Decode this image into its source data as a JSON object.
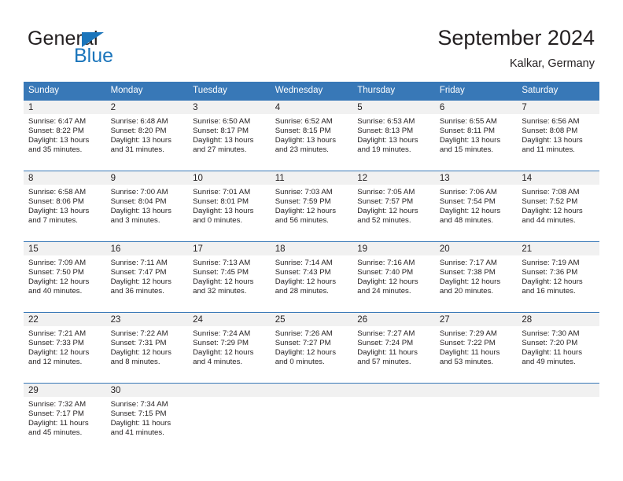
{
  "brand": {
    "name_part1": "General",
    "name_part2": "Blue",
    "triangle_color": "#1b75bb"
  },
  "header": {
    "title": "September 2024",
    "subtitle": "Kalkar, Germany"
  },
  "theme": {
    "header_blue": "#3878b7",
    "daynum_band": "#f1f1f1",
    "text": "#231f20"
  },
  "weekday_headers": [
    "Sunday",
    "Monday",
    "Tuesday",
    "Wednesday",
    "Thursday",
    "Friday",
    "Saturday"
  ],
  "weeks": [
    [
      {
        "day": "1",
        "sunrise": "Sunrise: 6:47 AM",
        "sunset": "Sunset: 8:22 PM",
        "daylight1": "Daylight: 13 hours",
        "daylight2": "and 35 minutes."
      },
      {
        "day": "2",
        "sunrise": "Sunrise: 6:48 AM",
        "sunset": "Sunset: 8:20 PM",
        "daylight1": "Daylight: 13 hours",
        "daylight2": "and 31 minutes."
      },
      {
        "day": "3",
        "sunrise": "Sunrise: 6:50 AM",
        "sunset": "Sunset: 8:17 PM",
        "daylight1": "Daylight: 13 hours",
        "daylight2": "and 27 minutes."
      },
      {
        "day": "4",
        "sunrise": "Sunrise: 6:52 AM",
        "sunset": "Sunset: 8:15 PM",
        "daylight1": "Daylight: 13 hours",
        "daylight2": "and 23 minutes."
      },
      {
        "day": "5",
        "sunrise": "Sunrise: 6:53 AM",
        "sunset": "Sunset: 8:13 PM",
        "daylight1": "Daylight: 13 hours",
        "daylight2": "and 19 minutes."
      },
      {
        "day": "6",
        "sunrise": "Sunrise: 6:55 AM",
        "sunset": "Sunset: 8:11 PM",
        "daylight1": "Daylight: 13 hours",
        "daylight2": "and 15 minutes."
      },
      {
        "day": "7",
        "sunrise": "Sunrise: 6:56 AM",
        "sunset": "Sunset: 8:08 PM",
        "daylight1": "Daylight: 13 hours",
        "daylight2": "and 11 minutes."
      }
    ],
    [
      {
        "day": "8",
        "sunrise": "Sunrise: 6:58 AM",
        "sunset": "Sunset: 8:06 PM",
        "daylight1": "Daylight: 13 hours",
        "daylight2": "and 7 minutes."
      },
      {
        "day": "9",
        "sunrise": "Sunrise: 7:00 AM",
        "sunset": "Sunset: 8:04 PM",
        "daylight1": "Daylight: 13 hours",
        "daylight2": "and 3 minutes."
      },
      {
        "day": "10",
        "sunrise": "Sunrise: 7:01 AM",
        "sunset": "Sunset: 8:01 PM",
        "daylight1": "Daylight: 13 hours",
        "daylight2": "and 0 minutes."
      },
      {
        "day": "11",
        "sunrise": "Sunrise: 7:03 AM",
        "sunset": "Sunset: 7:59 PM",
        "daylight1": "Daylight: 12 hours",
        "daylight2": "and 56 minutes."
      },
      {
        "day": "12",
        "sunrise": "Sunrise: 7:05 AM",
        "sunset": "Sunset: 7:57 PM",
        "daylight1": "Daylight: 12 hours",
        "daylight2": "and 52 minutes."
      },
      {
        "day": "13",
        "sunrise": "Sunrise: 7:06 AM",
        "sunset": "Sunset: 7:54 PM",
        "daylight1": "Daylight: 12 hours",
        "daylight2": "and 48 minutes."
      },
      {
        "day": "14",
        "sunrise": "Sunrise: 7:08 AM",
        "sunset": "Sunset: 7:52 PM",
        "daylight1": "Daylight: 12 hours",
        "daylight2": "and 44 minutes."
      }
    ],
    [
      {
        "day": "15",
        "sunrise": "Sunrise: 7:09 AM",
        "sunset": "Sunset: 7:50 PM",
        "daylight1": "Daylight: 12 hours",
        "daylight2": "and 40 minutes."
      },
      {
        "day": "16",
        "sunrise": "Sunrise: 7:11 AM",
        "sunset": "Sunset: 7:47 PM",
        "daylight1": "Daylight: 12 hours",
        "daylight2": "and 36 minutes."
      },
      {
        "day": "17",
        "sunrise": "Sunrise: 7:13 AM",
        "sunset": "Sunset: 7:45 PM",
        "daylight1": "Daylight: 12 hours",
        "daylight2": "and 32 minutes."
      },
      {
        "day": "18",
        "sunrise": "Sunrise: 7:14 AM",
        "sunset": "Sunset: 7:43 PM",
        "daylight1": "Daylight: 12 hours",
        "daylight2": "and 28 minutes."
      },
      {
        "day": "19",
        "sunrise": "Sunrise: 7:16 AM",
        "sunset": "Sunset: 7:40 PM",
        "daylight1": "Daylight: 12 hours",
        "daylight2": "and 24 minutes."
      },
      {
        "day": "20",
        "sunrise": "Sunrise: 7:17 AM",
        "sunset": "Sunset: 7:38 PM",
        "daylight1": "Daylight: 12 hours",
        "daylight2": "and 20 minutes."
      },
      {
        "day": "21",
        "sunrise": "Sunrise: 7:19 AM",
        "sunset": "Sunset: 7:36 PM",
        "daylight1": "Daylight: 12 hours",
        "daylight2": "and 16 minutes."
      }
    ],
    [
      {
        "day": "22",
        "sunrise": "Sunrise: 7:21 AM",
        "sunset": "Sunset: 7:33 PM",
        "daylight1": "Daylight: 12 hours",
        "daylight2": "and 12 minutes."
      },
      {
        "day": "23",
        "sunrise": "Sunrise: 7:22 AM",
        "sunset": "Sunset: 7:31 PM",
        "daylight1": "Daylight: 12 hours",
        "daylight2": "and 8 minutes."
      },
      {
        "day": "24",
        "sunrise": "Sunrise: 7:24 AM",
        "sunset": "Sunset: 7:29 PM",
        "daylight1": "Daylight: 12 hours",
        "daylight2": "and 4 minutes."
      },
      {
        "day": "25",
        "sunrise": "Sunrise: 7:26 AM",
        "sunset": "Sunset: 7:27 PM",
        "daylight1": "Daylight: 12 hours",
        "daylight2": "and 0 minutes."
      },
      {
        "day": "26",
        "sunrise": "Sunrise: 7:27 AM",
        "sunset": "Sunset: 7:24 PM",
        "daylight1": "Daylight: 11 hours",
        "daylight2": "and 57 minutes."
      },
      {
        "day": "27",
        "sunrise": "Sunrise: 7:29 AM",
        "sunset": "Sunset: 7:22 PM",
        "daylight1": "Daylight: 11 hours",
        "daylight2": "and 53 minutes."
      },
      {
        "day": "28",
        "sunrise": "Sunrise: 7:30 AM",
        "sunset": "Sunset: 7:20 PM",
        "daylight1": "Daylight: 11 hours",
        "daylight2": "and 49 minutes."
      }
    ],
    [
      {
        "day": "29",
        "sunrise": "Sunrise: 7:32 AM",
        "sunset": "Sunset: 7:17 PM",
        "daylight1": "Daylight: 11 hours",
        "daylight2": "and 45 minutes."
      },
      {
        "day": "30",
        "sunrise": "Sunrise: 7:34 AM",
        "sunset": "Sunset: 7:15 PM",
        "daylight1": "Daylight: 11 hours",
        "daylight2": "and 41 minutes."
      },
      {
        "day": "",
        "sunrise": "",
        "sunset": "",
        "daylight1": "",
        "daylight2": ""
      },
      {
        "day": "",
        "sunrise": "",
        "sunset": "",
        "daylight1": "",
        "daylight2": ""
      },
      {
        "day": "",
        "sunrise": "",
        "sunset": "",
        "daylight1": "",
        "daylight2": ""
      },
      {
        "day": "",
        "sunrise": "",
        "sunset": "",
        "daylight1": "",
        "daylight2": ""
      },
      {
        "day": "",
        "sunrise": "",
        "sunset": "",
        "daylight1": "",
        "daylight2": ""
      }
    ]
  ]
}
